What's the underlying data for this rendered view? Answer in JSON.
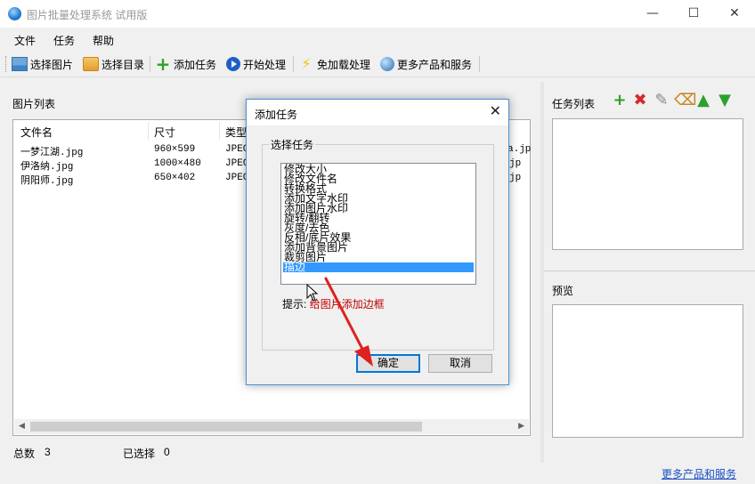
{
  "window": {
    "title": "图片批量处理系统 试用版",
    "minimize": "—",
    "maximize": "☐",
    "close": "✕"
  },
  "menu": [
    "文件",
    "任务",
    "帮助"
  ],
  "toolbar": [
    {
      "label": "选择图片",
      "icon": "picture-icon"
    },
    {
      "label": "选择目录",
      "icon": "folder-icon"
    },
    {
      "label": "添加任务",
      "icon": "plus-icon"
    },
    {
      "label": "开始处理",
      "icon": "play-icon"
    },
    {
      "label": "免加载处理",
      "icon": "bolt-icon"
    },
    {
      "label": "更多产品和服务",
      "icon": "globe-icon"
    }
  ],
  "image_list": {
    "title": "图片列表",
    "columns": [
      "文件名",
      "尺寸",
      "类型"
    ],
    "rows": [
      {
        "name": "一梦江湖.jpg",
        "size": "960×599",
        "type": "JPEG",
        "tail": "a.jp"
      },
      {
        "name": "伊洛纳.jpg",
        "size": "1000×480",
        "type": "JPEG",
        "tail": "jp"
      },
      {
        "name": "阴阳师.jpg",
        "size": "650×402",
        "type": "JPEG",
        "tail": "jp"
      }
    ],
    "total_label": "总数",
    "total_value": "3",
    "selected_label": "已选择",
    "selected_value": "0"
  },
  "task_panel": {
    "title": "任务列表",
    "icons": [
      "add-icon",
      "delete-icon",
      "settings-icon",
      "clear-icon",
      "move-up-icon",
      "move-down-icon"
    ]
  },
  "preview": {
    "title": "预览"
  },
  "footer_link": "更多产品和服务",
  "dialog": {
    "title": "添加任务",
    "group_label": "选择任务",
    "tasks": [
      "修改大小",
      "修改文件名",
      "转换格式",
      "添加文字水印",
      "添加图片水印",
      "旋转/翻转",
      "灰度/去色",
      "反相/底片效果",
      "添加背景图片",
      "裁剪图片",
      "描边"
    ],
    "selected_index": 10,
    "hint_label": "提示:",
    "hint_text": "给图片添加边框",
    "ok_label": "确定",
    "cancel_label": "取消"
  },
  "colors": {
    "selection": "#3399ff",
    "hint": "#c00000",
    "link": "#1a4fc4",
    "arrow": "#e02020"
  }
}
